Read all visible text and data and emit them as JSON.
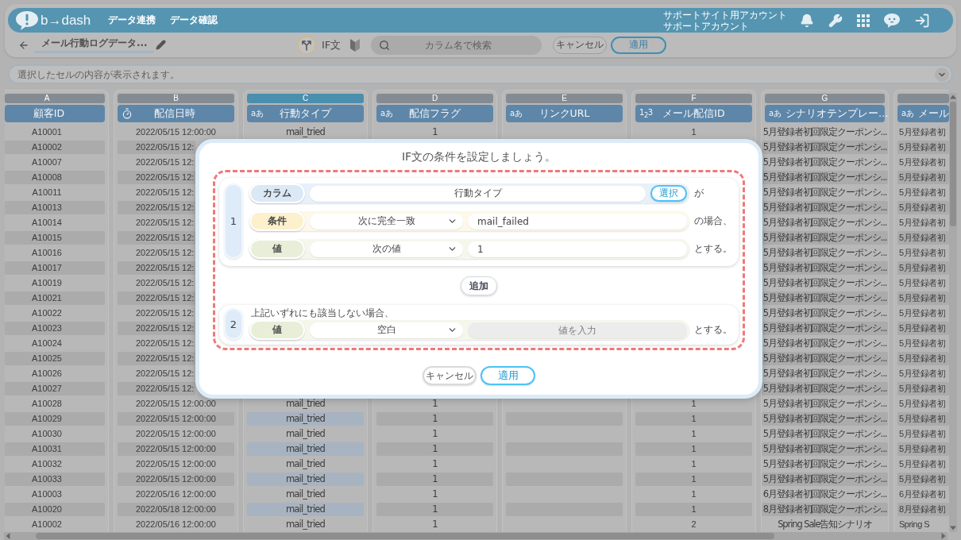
{
  "header": {
    "logo_text": "b→dash",
    "nav": [
      {
        "label": "データ連携"
      },
      {
        "label": "データ確認"
      }
    ],
    "account_lines": [
      "サポートサイト用アカウント",
      "サポートアカウント"
    ]
  },
  "toolbar": {
    "title": "メール行動ログデータ...",
    "mode_label": "IF文",
    "search": {
      "placeholder": "カラム名で検索"
    },
    "buttons": [
      {
        "label": "キャンセル",
        "kind": "secondary"
      },
      {
        "label": "適用",
        "kind": "primary"
      }
    ]
  },
  "cell_preview": {
    "placeholder": "選択したセルの内容が表示されます。"
  },
  "table": {
    "columns": [
      {
        "letter": "A",
        "name": "顧客ID",
        "kind": "plain",
        "selected": false
      },
      {
        "letter": "B",
        "name": "配信日時",
        "kind": "datetime",
        "selected": false
      },
      {
        "letter": "C",
        "name": "行動タイプ",
        "kind": "text",
        "type_glyph": "aあ",
        "selected": true
      },
      {
        "letter": "D",
        "name": "配信フラグ",
        "kind": "text",
        "type_glyph": "aあ",
        "selected": false
      },
      {
        "letter": "E",
        "name": "リンクURL",
        "kind": "text",
        "type_glyph": "aあ",
        "selected": false
      },
      {
        "letter": "F",
        "name": "メール配信ID",
        "kind": "number",
        "type_glyph": "1$_{2}$3",
        "selected": false
      },
      {
        "letter": "G",
        "name": "シナリオテンプレー…",
        "kind": "text",
        "type_glyph": "aあ",
        "selected": false
      },
      {
        "name": "メール",
        "kind": "text",
        "type_glyph": "aあ",
        "selected": false
      }
    ],
    "rows": [
      [
        "A10001",
        "2022/05/15 12:00:00",
        "mail_tried",
        "1",
        null,
        "1",
        "5月登録者初回限定クーポンシ...",
        "5月登録者初"
      ],
      [
        "A10002",
        "2022/05/15 12:",
        null,
        null,
        null,
        null,
        "5月登録者初回限定クーポンシ...",
        "5月登録者初"
      ],
      [
        "A10007",
        "2022/05/15 12:",
        null,
        null,
        null,
        null,
        "5月登録者初回限定クーポンシ...",
        "5月登録者初"
      ],
      [
        "A10008",
        "2022/05/15 12:",
        null,
        null,
        null,
        null,
        "5月登録者初回限定クーポンシ...",
        "5月登録者初"
      ],
      [
        "A10011",
        "2022/05/15 12:",
        null,
        null,
        null,
        null,
        "5月登録者初回限定クーポンシ...",
        "5月登録者初"
      ],
      [
        "A10013",
        "2022/05/15 12:",
        null,
        null,
        null,
        null,
        "5月登録者初回限定クーポンシ...",
        "5月登録者初"
      ],
      [
        "A10014",
        "2022/05/15 12:",
        null,
        null,
        null,
        null,
        "5月登録者初回限定クーポンシ...",
        "5月登録者初"
      ],
      [
        "A10015",
        "2022/05/15 12:",
        null,
        null,
        null,
        null,
        "5月登録者初回限定クーポンシ...",
        "5月登録者初"
      ],
      [
        "A10016",
        "2022/05/15 12:",
        null,
        null,
        null,
        null,
        "5月登録者初回限定クーポンシ...",
        "5月登録者初"
      ],
      [
        "A10017",
        "2022/05/15 12:",
        null,
        null,
        null,
        null,
        "5月登録者初回限定クーポンシ...",
        "5月登録者初"
      ],
      [
        "A10019",
        "2022/05/15 12:",
        null,
        null,
        null,
        null,
        "5月登録者初回限定クーポンシ...",
        "5月登録者初"
      ],
      [
        "A10021",
        "2022/05/15 12:",
        null,
        null,
        null,
        null,
        "5月登録者初回限定クーポンシ...",
        "5月登録者初"
      ],
      [
        "A10022",
        "2022/05/15 12:",
        null,
        null,
        null,
        null,
        "5月登録者初回限定クーポンシ...",
        "5月登録者初"
      ],
      [
        "A10023",
        "2022/05/15 12:",
        null,
        null,
        null,
        null,
        "5月登録者初回限定クーポンシ...",
        "5月登録者初"
      ],
      [
        "A10024",
        "2022/05/15 12:",
        null,
        null,
        null,
        null,
        "5月登録者初回限定クーポンシ...",
        "5月登録者初"
      ],
      [
        "A10025",
        "2022/05/15 12:",
        null,
        null,
        null,
        null,
        "5月登録者初回限定クーポンシ...",
        "5月登録者初"
      ],
      [
        "A10026",
        "2022/05/15 12:",
        null,
        null,
        null,
        null,
        "5月登録者初回限定クーポンシ...",
        "5月登録者初"
      ],
      [
        "A10027",
        "2022/05/15 12:",
        null,
        null,
        null,
        null,
        "5月登録者初回限定クーポンシ...",
        "5月登録者初"
      ],
      [
        "A10028",
        "2022/05/15 12:00:00",
        "mail_tried",
        "1",
        null,
        "1",
        "5月登録者初回限定クーポンシ...",
        "5月登録者初"
      ],
      [
        "A10029",
        "2022/05/15 12:00:00",
        "mail_tried",
        "1",
        null,
        "1",
        "5月登録者初回限定クーポンシ...",
        "5月登録者初"
      ],
      [
        "A10030",
        "2022/05/15 12:00:00",
        "mail_tried",
        "1",
        null,
        "1",
        "5月登録者初回限定クーポンシ...",
        "5月登録者初"
      ],
      [
        "A10031",
        "2022/05/15 12:00:00",
        "mail_tried",
        "1",
        null,
        "1",
        "5月登録者初回限定クーポンシ...",
        "5月登録者初"
      ],
      [
        "A10032",
        "2022/05/15 12:00:00",
        "mail_tried",
        "1",
        null,
        "1",
        "5月登録者初回限定クーポンシ...",
        "5月登録者初"
      ],
      [
        "A10033",
        "2022/05/15 12:00:00",
        "mail_tried",
        "1",
        null,
        "1",
        "5月登録者初回限定クーポンシ...",
        "5月登録者初"
      ],
      [
        "A10003",
        "2022/05/16 12:00:00",
        "mail_tried",
        "1",
        null,
        "1",
        "6月登録者初回限定クーポンシ...",
        "6月登録者初"
      ],
      [
        "A10020",
        "2022/05/18 12:00:00",
        "mail_tried",
        "1",
        null,
        "1",
        "8月登録者初回限定クーポンシ...",
        "8月登録者初"
      ],
      [
        "A10002",
        "2022/05/16 12:00:00",
        "mail_tried",
        "1",
        null,
        "2",
        "Spring Sale告知シナリオ",
        "Spring S"
      ]
    ]
  },
  "if_dialog": {
    "title": "IF文の条件を設定しましょう。",
    "branches": [
      {
        "number": "1",
        "rows": [
          {
            "kind": "column",
            "label": "カラム",
            "value": "行動タイプ",
            "action": "選択",
            "disabled": false,
            "suffix": "が"
          },
          {
            "kind": "condition",
            "label": "条件",
            "operator": "次に完全一致",
            "value": "mail_failed",
            "disabled": false,
            "suffix": "の場合、"
          },
          {
            "kind": "value",
            "label": "値",
            "operator": "次の値",
            "value": "1",
            "disabled": false,
            "suffix": "とする。"
          }
        ]
      }
    ],
    "add_label": "追加",
    "fallback": {
      "number": "2",
      "note": "上記いずれにも該当しない場合、",
      "rows": [
        {
          "kind": "value",
          "label": "値",
          "operator": "空白",
          "placeholder": "値を入力",
          "disabled": true,
          "suffix": "とする。"
        }
      ]
    },
    "buttons": [
      {
        "label": "キャンセル",
        "kind": "secondary"
      },
      {
        "label": "適用",
        "kind": "primary"
      }
    ]
  }
}
